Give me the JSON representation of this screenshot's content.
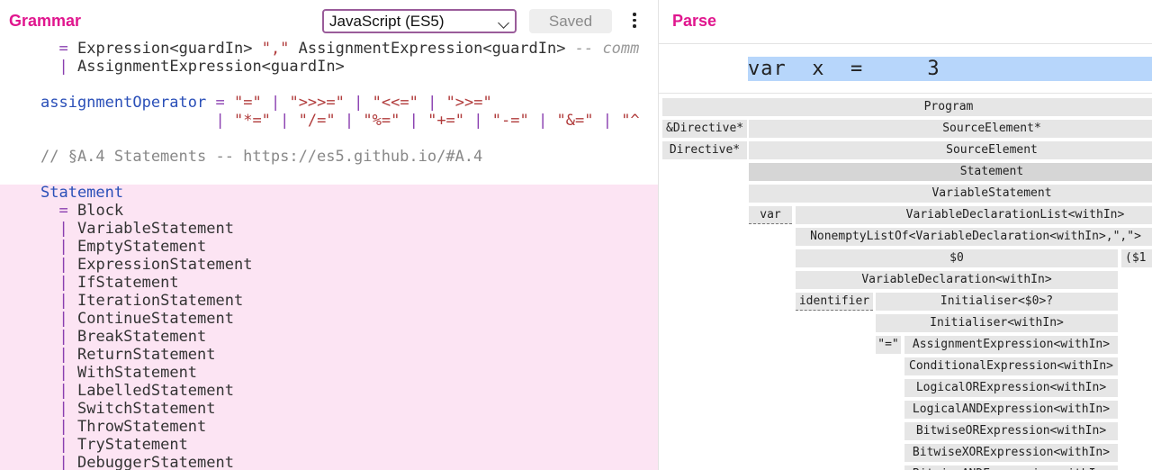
{
  "grammar_pane": {
    "title": "Grammar",
    "language_select": {
      "selected": "JavaScript (ES5)"
    },
    "saved_button": "Saved",
    "more_icon": "more-vertical-icon",
    "code_lines": [
      "  = Expression<guardIn> \",\" AssignmentExpression<guardIn> -- comm",
      "  | AssignmentExpression<guardIn>",
      "",
      "assignmentOperator = \"=\" | \">>>=\" | \"<<=\" | \">>=\"",
      "                   | \"*=\" | \"/=\" | \"%=\" | \"+=\" | \"-=\" | \"&=\" | \"^",
      "",
      "// §A.4 Statements -- https://es5.github.io/#A.4",
      "",
      "Statement",
      "  = Block",
      "  | VariableStatement",
      "  | EmptyStatement",
      "  | ExpressionStatement",
      "  | IfStatement",
      "  | IterationStatement",
      "  | ContinueStatement",
      "  | BreakStatement",
      "  | ReturnStatement",
      "  | WithStatement",
      "  | LabelledStatement",
      "  | SwitchStatement",
      "  | ThrowStatement",
      "  | TryStatement",
      "  | DebuggerStatement"
    ],
    "highlight_color": "#fce4f3"
  },
  "parse_pane": {
    "title": "Parse",
    "input_text": "var  x  =     3",
    "input_highlight_color": "#b7d6fb",
    "tree": [
      {
        "label": "Program"
      },
      {
        "label": "&Directive*"
      },
      {
        "label": "SourceElement*"
      },
      {
        "label": "Directive*"
      },
      {
        "label": "SourceElement"
      },
      {
        "label": "Statement"
      },
      {
        "label": "VariableStatement"
      },
      {
        "label": "var"
      },
      {
        "label": "VariableDeclarationList<withIn>"
      },
      {
        "label": "NonemptyListOf<VariableDeclaration<withIn>,\",\">"
      },
      {
        "label": "$0"
      },
      {
        "label": "($1"
      },
      {
        "label": "VariableDeclaration<withIn>"
      },
      {
        "label": "identifier"
      },
      {
        "label": "Initialiser<$0>?"
      },
      {
        "label": "Initialiser<withIn>"
      },
      {
        "label": "\"=\""
      },
      {
        "label": "AssignmentExpression<withIn>"
      },
      {
        "label": "ConditionalExpression<withIn>"
      },
      {
        "label": "LogicalORExpression<withIn>"
      },
      {
        "label": "LogicalANDExpression<withIn>"
      },
      {
        "label": "BitwiseORExpression<withIn>"
      },
      {
        "label": "BitwiseXORExpression<withIn>"
      },
      {
        "label": "BitwiseANDExpression<withIn>"
      }
    ]
  },
  "colors": {
    "title_accent": "#e0168e",
    "node_bg": "#e6e6e6",
    "keyword_blue": "#2a4fb8",
    "string_red": "#b03a3a",
    "operator_purple": "#8a3fb0"
  }
}
